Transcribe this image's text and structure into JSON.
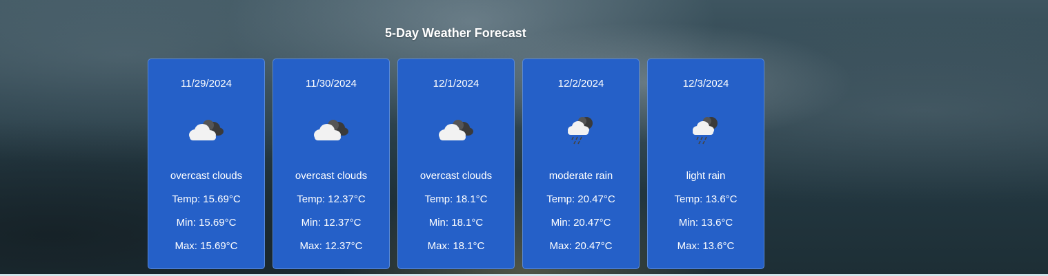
{
  "title": "5-Day Weather Forecast",
  "days": [
    {
      "date": "11/29/2024",
      "icon": "overcast-clouds-icon",
      "description": "overcast clouds",
      "temp": "Temp: 15.69°C",
      "min": "Min: 15.69°C",
      "max": "Max: 15.69°C"
    },
    {
      "date": "11/30/2024",
      "icon": "overcast-clouds-icon",
      "description": "overcast clouds",
      "temp": "Temp: 12.37°C",
      "min": "Min: 12.37°C",
      "max": "Max: 12.37°C"
    },
    {
      "date": "12/1/2024",
      "icon": "overcast-clouds-icon",
      "description": "overcast clouds",
      "temp": "Temp: 18.1°C",
      "min": "Min: 18.1°C",
      "max": "Max: 18.1°C"
    },
    {
      "date": "12/2/2024",
      "icon": "rain-cloud-icon",
      "description": "moderate rain",
      "temp": "Temp: 20.47°C",
      "min": "Min: 20.47°C",
      "max": "Max: 20.47°C"
    },
    {
      "date": "12/3/2024",
      "icon": "rain-cloud-icon",
      "description": "light rain",
      "temp": "Temp: 13.6°C",
      "min": "Min: 13.6°C",
      "max": "Max: 13.6°C"
    }
  ],
  "colors": {
    "card_background": "#2560c8",
    "card_border": "#5a8ad8",
    "text": "#ffffff"
  }
}
